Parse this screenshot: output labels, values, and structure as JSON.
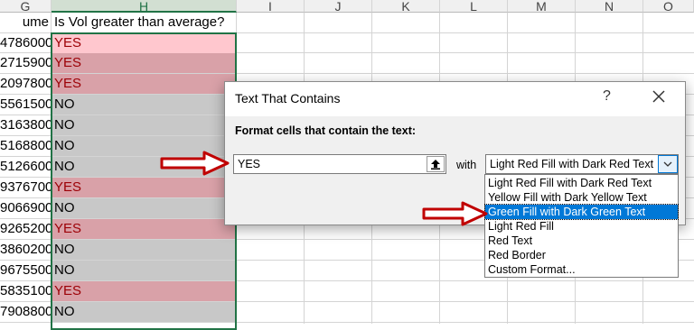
{
  "columns": [
    "G",
    "H",
    "I",
    "J",
    "K",
    "L",
    "M",
    "N",
    "O"
  ],
  "selected_column": "H",
  "sheet": {
    "g_header": "ume",
    "h_header": "Is Vol greater than average?",
    "rows": [
      {
        "g": "4786000",
        "h": "YES"
      },
      {
        "g": "2715900",
        "h": "YES"
      },
      {
        "g": "2097800",
        "h": "YES"
      },
      {
        "g": "5561500",
        "h": "NO"
      },
      {
        "g": "3163800",
        "h": "NO"
      },
      {
        "g": "5168800",
        "h": "NO"
      },
      {
        "g": "5126600",
        "h": "NO"
      },
      {
        "g": "9376700",
        "h": "YES"
      },
      {
        "g": "9066900",
        "h": "NO"
      },
      {
        "g": "9265200",
        "h": "YES"
      },
      {
        "g": "3860200",
        "h": "NO"
      },
      {
        "g": "9675500",
        "h": "NO"
      },
      {
        "g": "5835100",
        "h": "YES"
      },
      {
        "g": "7908800",
        "h": "NO"
      }
    ]
  },
  "dialog": {
    "title": "Text That Contains",
    "help": "?",
    "prompt": "Format cells that contain the text:",
    "input_value": "YES",
    "with_label": "with",
    "selected_format": "Light Red Fill with Dark Red Text"
  },
  "dropdown": {
    "items": [
      "Light Red Fill with Dark Red Text",
      "Yellow Fill with Dark Yellow Text",
      "Green Fill with Dark Green Text",
      "Light Red Fill",
      "Red Text",
      "Red Border",
      "Custom Format..."
    ],
    "highlighted_index": 2
  },
  "colors": {
    "excel_green": "#217346",
    "yes_fill": "#d9a1a8",
    "yes_text": "#9c0006",
    "no_fill": "#c8c8c8",
    "arrow_red": "#c00000",
    "selection_blue": "#0078d7"
  },
  "icons": [
    "collapse-dialog-icon",
    "close-icon",
    "dropdown-chevron-icon",
    "callout-arrow-icon"
  ]
}
